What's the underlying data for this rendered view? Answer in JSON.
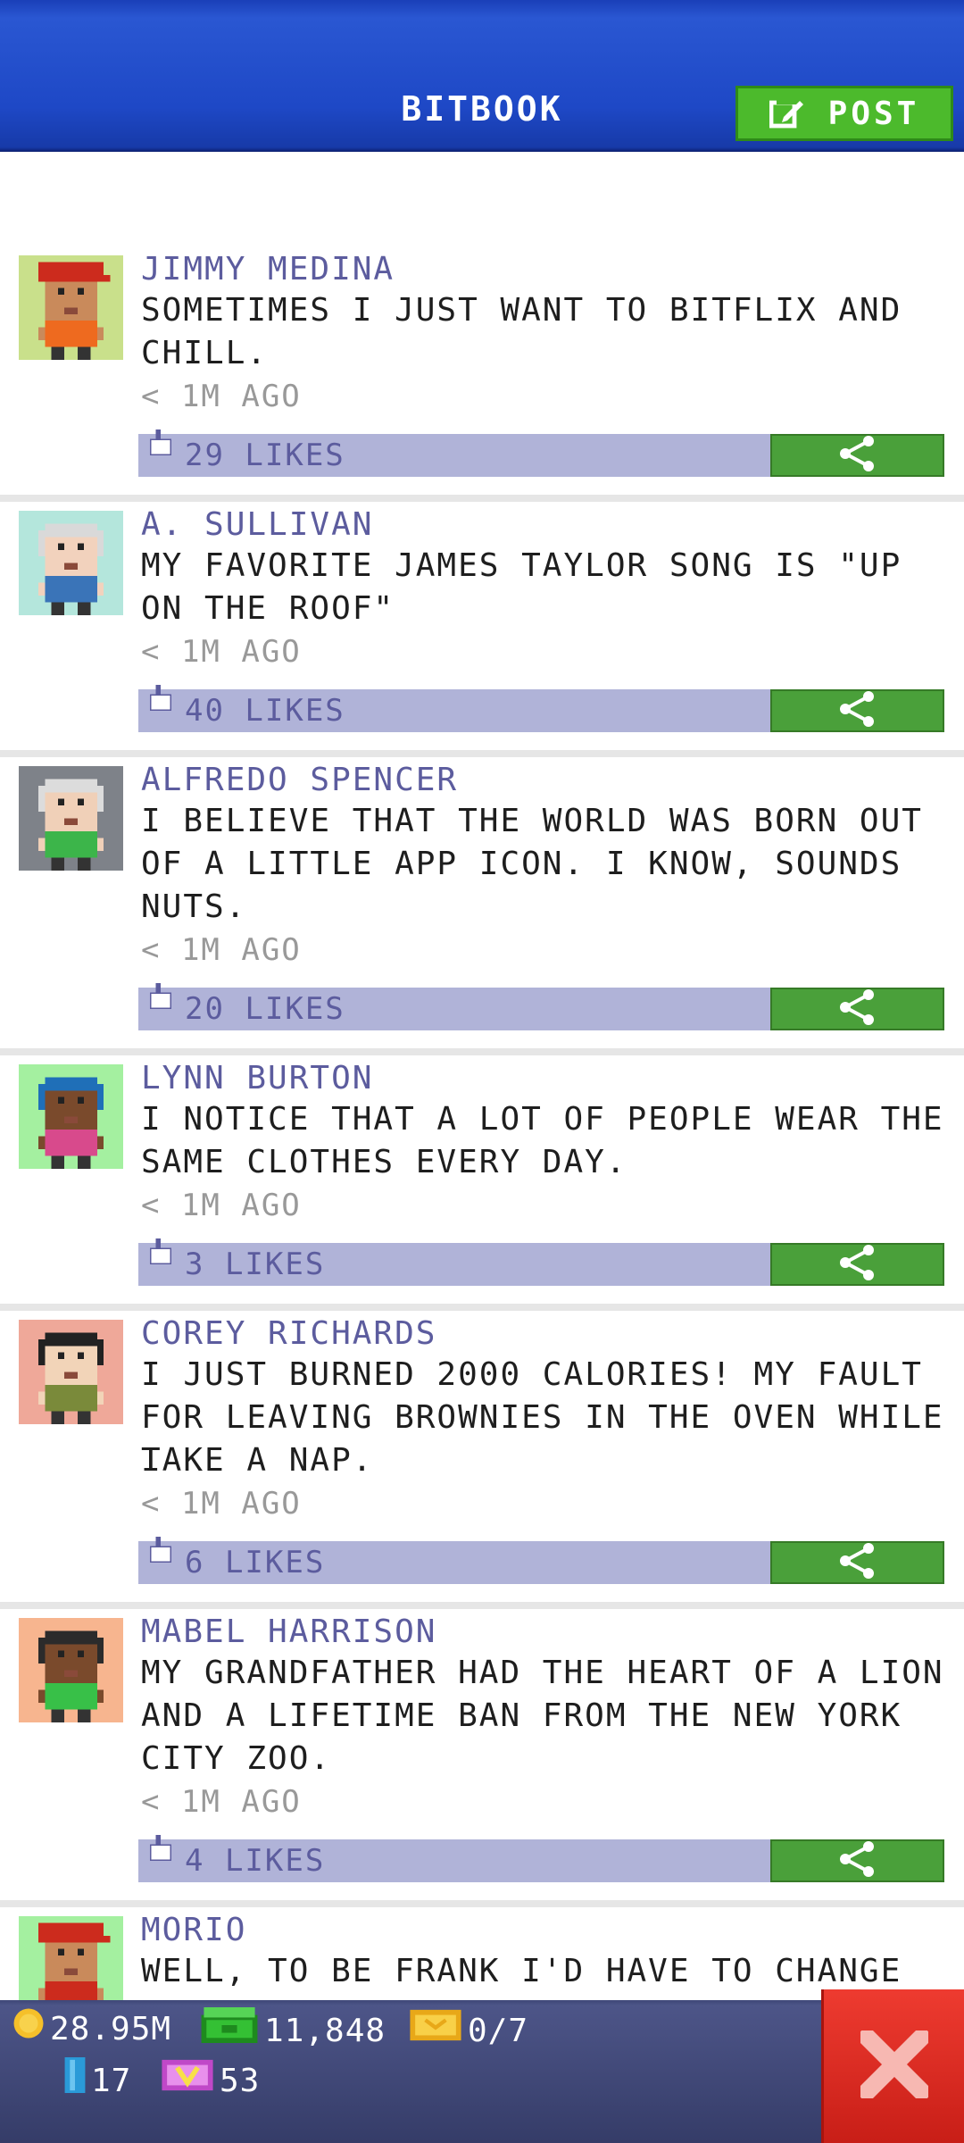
{
  "header": {
    "title": "BITBOOK",
    "post_label": "POST"
  },
  "posts": [
    {
      "name": "JIMMY MEDINA",
      "lines": [
        "SOMETIMES I JUST WANT TO BITFLIX AND",
        "CHILL."
      ],
      "time": "< 1M AGO",
      "likes": "29 LIKES",
      "avatar_bg": "#c9e08b",
      "skin": "#c98a5b",
      "hair": "#cc2b1d",
      "shirt": "#ee6a1f",
      "hat": true
    },
    {
      "name": "A. SULLIVAN",
      "lines": [
        "MY FAVORITE JAMES TAYLOR SONG IS \"UP",
        "ON THE ROOF\""
      ],
      "time": "< 1M AGO",
      "likes": "40 LIKES",
      "avatar_bg": "#b4e6dc",
      "skin": "#f2d2bd",
      "hair": "#d9d9d9",
      "shirt": "#3a74b8",
      "hat": false
    },
    {
      "name": "ALFREDO SPENCER",
      "lines": [
        "I BELIEVE THAT THE WORLD WAS BORN OUT",
        "OF A LITTLE APP ICON. I KNOW, SOUNDS",
        "NUTS."
      ],
      "time": "< 1M AGO",
      "likes": "20 LIKES",
      "avatar_bg": "#7e8289",
      "skin": "#f0d0b8",
      "hair": "#dcdcdc",
      "shirt": "#3cb54a",
      "hat": false
    },
    {
      "name": "LYNN BURTON",
      "lines": [
        "I NOTICE THAT A LOT OF PEOPLE WEAR THE",
        "SAME CLOTHES EVERY DAY."
      ],
      "time": "< 1M AGO",
      "likes": "3 LIKES",
      "avatar_bg": "#a4f0a0",
      "skin": "#7a4a2c",
      "hair": "#1f6fb8",
      "shirt": "#d84a8c",
      "hat": false
    },
    {
      "name": "COREY RICHARDS",
      "lines": [
        "I JUST BURNED 2000 CALORIES! MY FAULT",
        "FOR LEAVING BROWNIES IN THE OVEN WHILE I",
        "TAKE A NAP."
      ],
      "time": "< 1M AGO",
      "likes": "6 LIKES",
      "avatar_bg": "#efa899",
      "skin": "#f2d4b8",
      "hair": "#222222",
      "shirt": "#7a8a3a",
      "hat": false
    },
    {
      "name": "MABEL HARRISON",
      "lines": [
        "MY GRANDFATHER HAD THE HEART OF A LION",
        "AND A LIFETIME BAN FROM THE NEW YORK",
        "CITY ZOO."
      ],
      "time": "< 1M AGO",
      "likes": "4 LIKES",
      "avatar_bg": "#f7b58f",
      "skin": "#7a4a2c",
      "hair": "#2b2b2b",
      "shirt": "#38c048",
      "hat": false
    },
    {
      "name": "MORIO",
      "lines": [
        "WELL, TO BE FRANK I'D HAVE TO CHANGE"
      ],
      "time": "",
      "likes": "",
      "avatar_bg": "#a4f0a0",
      "skin": "#c98a5b",
      "hair": "#cc2b1d",
      "shirt": "#cc2b1d",
      "hat": true
    }
  ],
  "stats": {
    "coins": "28.95M",
    "bux": "11,848",
    "tickets": "0/7",
    "cans": "17",
    "vip": "53"
  },
  "colors": {
    "header_blue": "#1e48c6",
    "post_green": "#4cba2c",
    "likes_bar": "#b0b3d8",
    "name_text": "#5c5c9e",
    "share_green": "#4aa03a",
    "close_red": "#e2312a",
    "bottom_bar": "#3e4778"
  }
}
